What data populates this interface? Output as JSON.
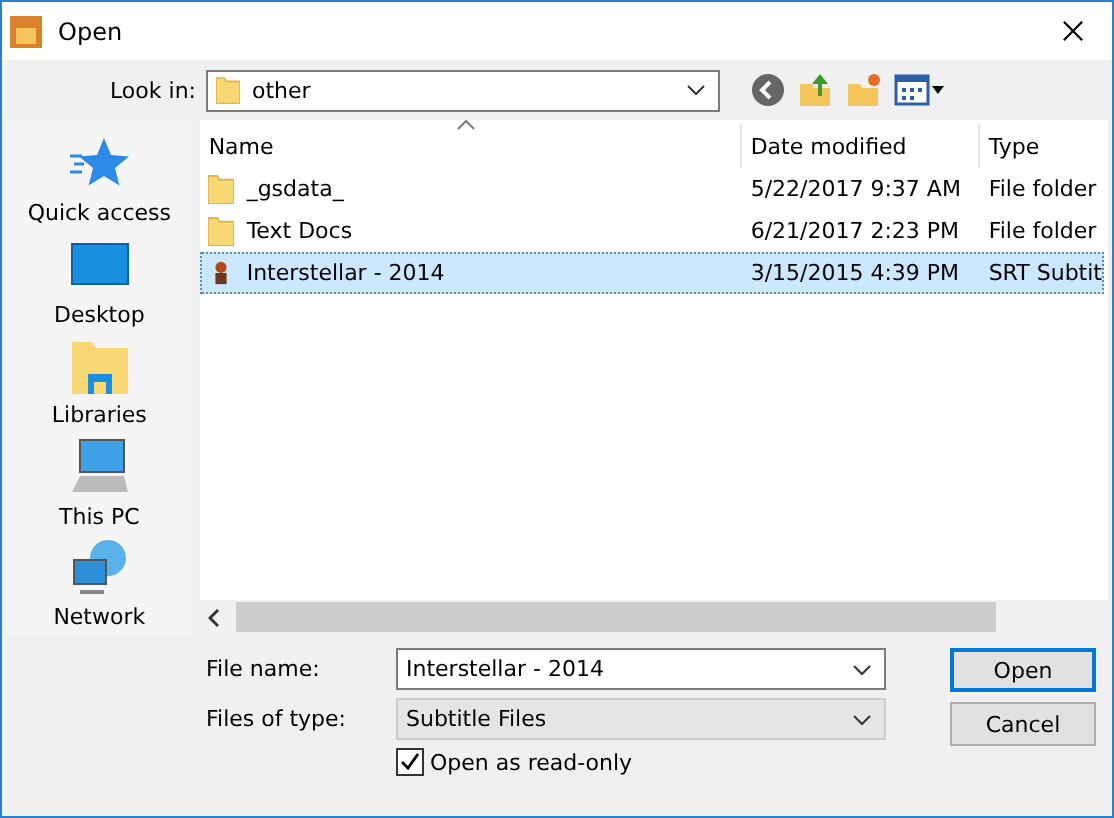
{
  "window": {
    "title": "Open"
  },
  "look_in": {
    "label": "Look in:",
    "value": "other"
  },
  "places": [
    {
      "label": "Quick access",
      "kind": "star"
    },
    {
      "label": "Desktop",
      "kind": "desktop"
    },
    {
      "label": "Libraries",
      "kind": "libraries"
    },
    {
      "label": "This PC",
      "kind": "pc"
    },
    {
      "label": "Network",
      "kind": "network"
    }
  ],
  "file_list": {
    "columns": [
      "Name",
      "Date modified",
      "Type"
    ],
    "rows": [
      {
        "name": "_gsdata_",
        "date": "5/22/2017 9:37 AM",
        "type": "File folder",
        "kind": "folder",
        "selected": false
      },
      {
        "name": "Text Docs",
        "date": "6/21/2017 2:23 PM",
        "type": "File folder",
        "kind": "folder",
        "selected": false
      },
      {
        "name": "Interstellar - 2014",
        "date": "3/15/2015 4:39 PM",
        "type": "SRT Subtit",
        "kind": "file",
        "selected": true
      }
    ]
  },
  "file_name": {
    "label": "File name:",
    "value": "Interstellar - 2014"
  },
  "file_type": {
    "label": "Files of type:",
    "value": "Subtitle Files"
  },
  "read_only": {
    "label": "Open as read-only",
    "checked": true
  },
  "buttons": [
    "Open",
    "Cancel"
  ]
}
